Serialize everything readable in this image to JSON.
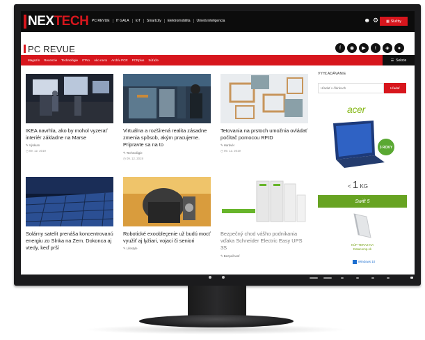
{
  "site": {
    "logo_part1": "NEX",
    "logo_part2": "TECH",
    "top_nav": [
      "PC REVUE",
      "IT GALA",
      "IoT",
      "Smartcity",
      "Elektromobilita",
      "Umelá inteligencia"
    ],
    "services_label": "Služby",
    "accent_color": "#d7161d"
  },
  "section": {
    "title": "PC REVUE",
    "nav": [
      "Magazín",
      "Recenzie",
      "Technológie",
      "ITPro",
      "Ako na to",
      "Archív PCR",
      "PCRplus",
      "Súťaže"
    ],
    "sections_label": "Sekcie",
    "social_icons": [
      "facebook-icon",
      "instagram-icon",
      "youtube-icon",
      "twitter-icon",
      "rss-icon",
      "podcast-icon"
    ]
  },
  "articles": [
    {
      "title": "IKEA navrhla, ako by mohol vyzerať interiér základne na Marse",
      "category": "Výskum",
      "date": "09. 12. 2019"
    },
    {
      "title": "Virtuálna a rozšírená realita zásadne zmenia spôsob, akým pracujeme. Pripravte sa na to",
      "category": "Technológie",
      "date": "09. 12. 2019"
    },
    {
      "title": "Tetovania na prstoch umožnia ovládať počítač pomocou RFID",
      "category": "Hardvér",
      "date": "09. 12. 2019"
    },
    {
      "title": "Solárny satelit prenáša koncentrovanú energiu zo Slnka na Zem. Dokonca aj vtedy, keď prší",
      "category": "",
      "date": ""
    },
    {
      "title": "Robotické exoobleçenie už budú mocť využiť aj lyžiari, vojaci či seniori",
      "category": "Lifestyle",
      "date": ""
    },
    {
      "title": "Bezpečný chod vášho podnikania vďaka Schneider Electric Easy UPS 3S",
      "category": "Bezpečnosť",
      "date": ""
    }
  ],
  "sidebar": {
    "search_label": "VYHĽADÁVANIE",
    "search_placeholder": "Hľadať v článkoch",
    "search_button": "Hľadať"
  },
  "ad": {
    "brand": "acer",
    "warranty": "3 ROKY",
    "weight_prefix": "< ",
    "weight_value": "1",
    "weight_unit": " KG",
    "product": "Swift 5",
    "cta": "KÚP TERAZ NA",
    "shop": "Datacomp.sk",
    "os": "Windows 10"
  }
}
